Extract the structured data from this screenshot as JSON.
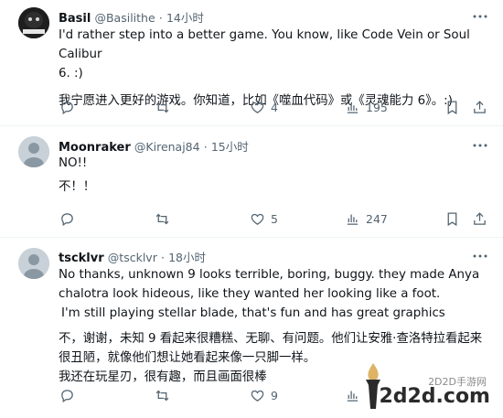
{
  "tweets": [
    {
      "name": "Basil",
      "handle": "@Basilithe",
      "dot": "·",
      "time": "14小时",
      "lines": [
        "I'd rather step into a better game. You know, like Code Vein or Soul Calibur",
        "6. :)",
        "我宁愿进入更好的游戏。你知道，比如《噬血代码》或《灵魂能力 6》。:)"
      ],
      "likes": "4",
      "views": "195"
    },
    {
      "name": "Moonraker",
      "handle": "@Kirenaj84",
      "dot": "·",
      "time": "15小时",
      "lines": [
        "NO!!",
        "不！！"
      ],
      "likes": "5",
      "views": "247"
    },
    {
      "name": "tscklvr",
      "handle": "@tscklvr",
      "dot": "·",
      "time": "18小时",
      "lines": [
        "No thanks, unknown 9 looks terrible, boring, buggy. they made Anya",
        "chalotra look hideous, like they wanted her looking like a foot.",
        "I'm still playing stellar blade, that's fun and has great graphics",
        "不，谢谢，未知 9 看起来很糟糕、无聊、有问题。他们让安雅·查洛特拉看起来",
        "很丑陋，就像他们想让她看起来像一只脚一样。",
        "我还在玩星刃，很有趣，而且画面很棒"
      ],
      "likes": "9",
      "views": ""
    }
  ],
  "watermark": {
    "top": "2D2D手游网",
    "main": "2d2d.com"
  },
  "colors": {
    "text": "#0f1419",
    "muted": "#536471",
    "divider": "#eff3f4"
  },
  "icons": [
    "reply-icon",
    "retweet-icon",
    "like-icon",
    "views-icon",
    "bookmark-icon",
    "share-icon",
    "more-icon"
  ]
}
